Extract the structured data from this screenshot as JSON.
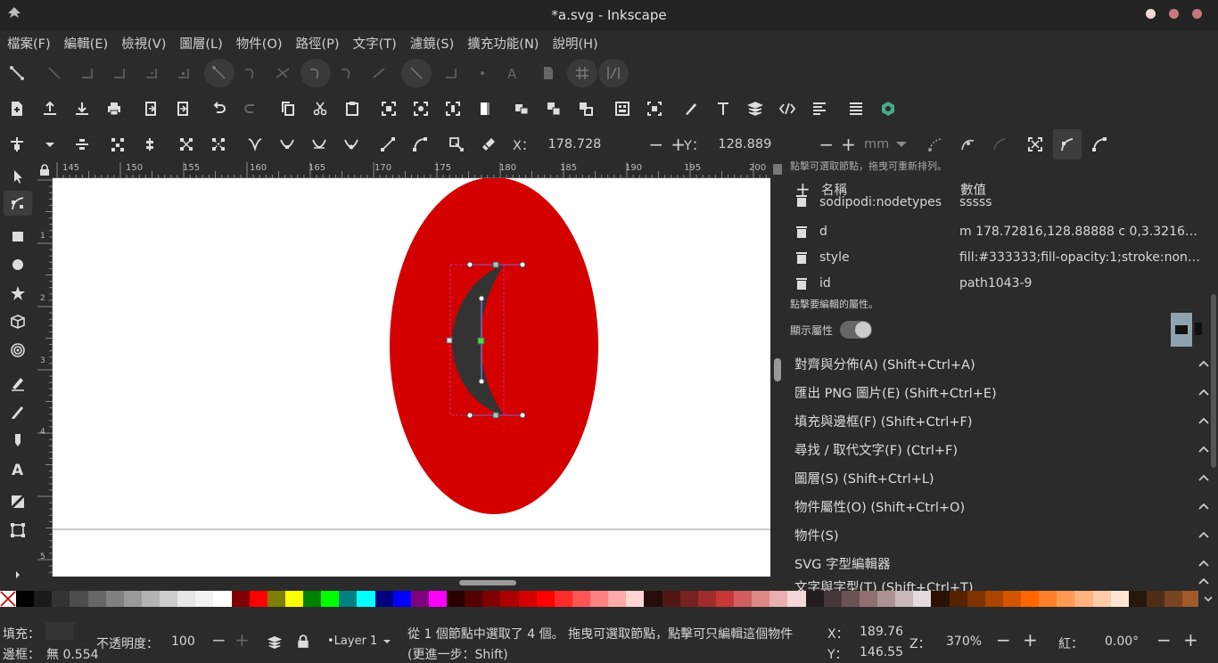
{
  "window": {
    "title": "*a.svg - Inkscape"
  },
  "menu": [
    "檔案(F)",
    "編輯(E)",
    "檢視(V)",
    "圖層(L)",
    "物件(O)",
    "路徑(P)",
    "文字(T)",
    "濾鏡(S)",
    "擴充功能(N)",
    "說明(H)"
  ],
  "node_toolbar": {
    "x_label": "X：",
    "x_value": "178.728",
    "x_minus": "−",
    "x_plus": "+",
    "y_label": "Y：",
    "y_value": "128.889",
    "y_minus": "−",
    "y_plus": "+",
    "unit": "mm"
  },
  "ruler": {
    "ticks": [
      "145",
      "150",
      "155",
      "160",
      "165",
      "170",
      "175",
      "180",
      "185",
      "190",
      "195",
      "200"
    ],
    "left": [
      "1",
      "2",
      "3",
      "4",
      "5"
    ]
  },
  "panel": {
    "hint_top": "點擊可選取節點，拖曳可重新排列。",
    "col_name": "名稱",
    "col_value": "數值",
    "rows": [
      {
        "name": "sodipodi:nodetypes",
        "value": "sssss"
      },
      {
        "name": "d",
        "value": "m 178.72816,128.88888 c 0,3.3216…"
      },
      {
        "name": "style",
        "value": "fill:#333333;fill-opacity:1;stroke:non…"
      },
      {
        "name": "id",
        "value": "path1043-9"
      }
    ],
    "hint": "點擊要編輯的屬性。",
    "show_attr_label": "顯示屬性",
    "docks": [
      "對齊與分佈(A) (Shift+Ctrl+A)",
      "匯出 PNG 圖片(E) (Shift+Ctrl+E)",
      "填充與邊框(F) (Shift+Ctrl+F)",
      "尋找 / 取代文字(F) (Ctrl+F)",
      "圖層(S) (Shift+Ctrl+L)",
      "物件屬性(O) (Shift+Ctrl+O)",
      "物件(S)",
      "SVG 字型編輯器",
      "文字與字型(T) (Shift+Ctrl+T)"
    ]
  },
  "status": {
    "fill_label": "填充：",
    "stroke_label": "邊框：",
    "stroke_value": "無 0.554",
    "opacity_label": "不透明度：",
    "opacity_value": "100",
    "layer": "•Layer 1",
    "message_line1": "從 1 個節點中選取了 4 個。 拖曳可選取節點，點擊可只編輯這個物件",
    "message_line2": "(更進一步：Shift)",
    "x_label": "X：",
    "x_value": "189.76",
    "y_label": "Y：",
    "y_value": "146.55",
    "zoom_label": "Z：",
    "zoom_value": "370%",
    "rot_label": "紅：",
    "rot_value": "0.00°"
  },
  "colors": {
    "ellipse": "#d40000",
    "crescent": "#333333",
    "accent": "#44aa88"
  }
}
